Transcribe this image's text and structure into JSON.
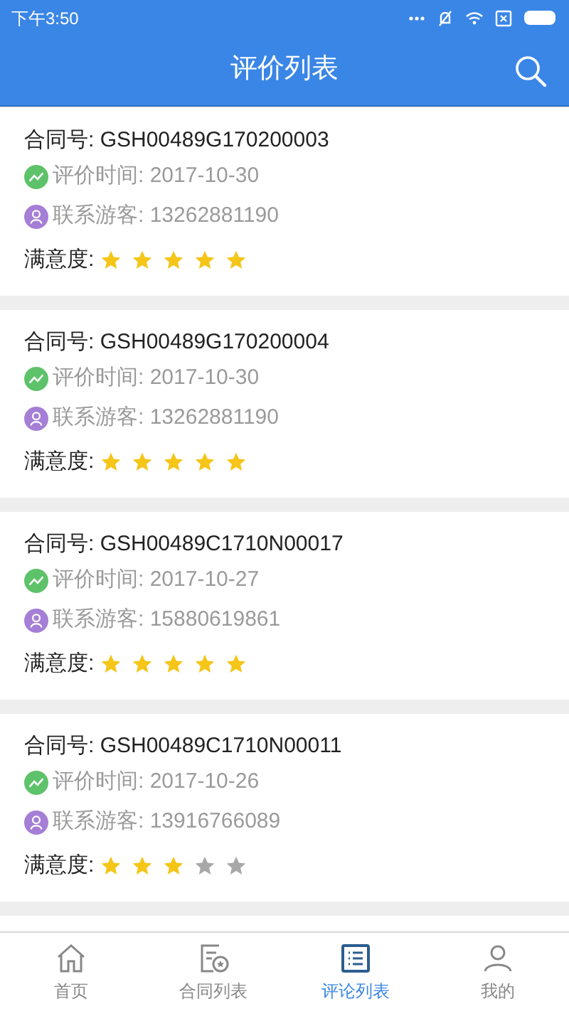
{
  "status_bar": {
    "time": "下午3:50"
  },
  "header": {
    "title": "评价列表"
  },
  "reviews": [
    {
      "contract": "合同号: GSH00489G170200003",
      "time": "评价时间: 2017-10-30",
      "contact": "联系游客: 13262881190",
      "satisfaction_label": "满意度:",
      "stars": 5
    },
    {
      "contract": "合同号: GSH00489G170200004",
      "time": "评价时间: 2017-10-30",
      "contact": "联系游客: 13262881190",
      "satisfaction_label": "满意度:",
      "stars": 5
    },
    {
      "contract": "合同号: GSH00489C1710N00017",
      "time": "评价时间: 2017-10-27",
      "contact": "联系游客: 15880619861",
      "satisfaction_label": "满意度:",
      "stars": 5
    },
    {
      "contract": "合同号: GSH00489C1710N00011",
      "time": "评价时间: 2017-10-26",
      "contact": "联系游客: 13916766089",
      "satisfaction_label": "满意度:",
      "stars": 3
    }
  ],
  "tabs": [
    {
      "label": "首页",
      "kind": "home",
      "selected": false
    },
    {
      "label": "合同列表",
      "kind": "contracts",
      "selected": false
    },
    {
      "label": "评论列表",
      "kind": "reviews",
      "selected": true
    },
    {
      "label": "我的",
      "kind": "profile",
      "selected": false
    }
  ]
}
